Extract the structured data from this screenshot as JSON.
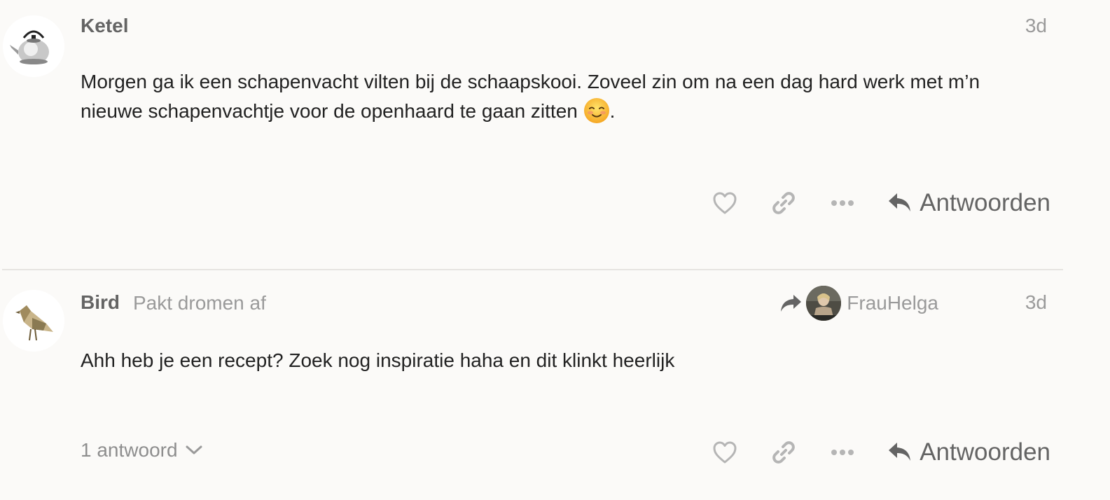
{
  "posts": [
    {
      "username": "Ketel",
      "date": "3d",
      "body_text": "Morgen ga ik een schapenvacht vilten bij de schaapskooi. Zoveel zin om na een dag hard werk met m’n nieuwe schapenvachtje voor de openhaard te gaan zitten ",
      "body_end": ".",
      "emoji": "smiling-face-icon",
      "reply_label": "Antwoorden"
    },
    {
      "username": "Bird",
      "user_title": "Pakt dromen af",
      "date": "3d",
      "reply_to_user": "FrauHelga",
      "body_text": "Ahh heb je een recept? Zoek nog inspiratie haha en dit klinkt heerlijk",
      "replies_label": "1 antwoord",
      "reply_label": "Antwoorden"
    }
  ],
  "icons": {
    "like": "heart-icon",
    "link": "link-icon",
    "more": "ellipsis-icon",
    "reply": "reply-arrow-icon",
    "reply_to": "share-arrow-icon",
    "expand": "chevron-down-icon"
  },
  "colors": {
    "background": "#fbfaf8",
    "muted_text": "#9a9a9a",
    "username": "#646464",
    "icon": "#b5b5b5",
    "divider": "#e6e4e1"
  }
}
